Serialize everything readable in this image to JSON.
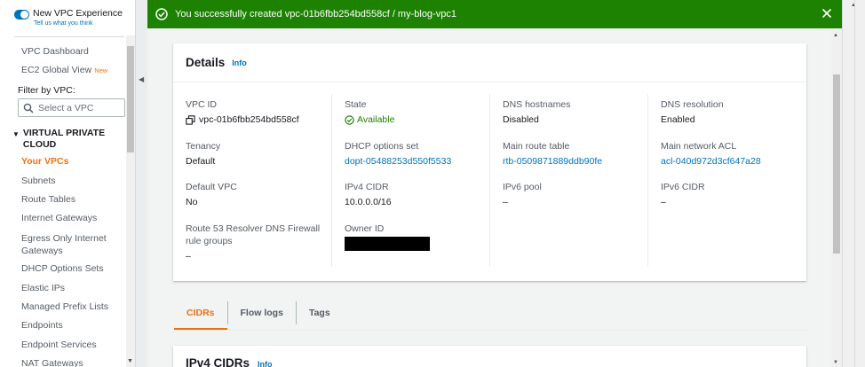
{
  "sidebar": {
    "toggle_title": "New VPC Experience",
    "toggle_subtitle": "Tell us what you think",
    "vpc_dashboard": "VPC Dashboard",
    "ec2_global_view": "EC2 Global View",
    "new_badge": "New",
    "filter_label": "Filter by VPC:",
    "search_placeholder": "Select a VPC",
    "section_title": "VIRTUAL PRIVATE CLOUD",
    "items": [
      "Your VPCs",
      "Subnets",
      "Route Tables",
      "Internet Gateways",
      "Egress Only Internet Gateways",
      "DHCP Options Sets",
      "Elastic IPs",
      "Managed Prefix Lists",
      "Endpoints",
      "Endpoint Services",
      "NAT Gateways"
    ]
  },
  "flash": {
    "message": "You successfully created vpc-01b6fbb254bd558cf / my-blog-vpc1",
    "color": "#1d8102"
  },
  "details": {
    "title": "Details",
    "info": "Info",
    "vpc_id_label": "VPC ID",
    "vpc_id_value": "vpc-01b6fbb254bd558cf",
    "state_label": "State",
    "state_value": "Available",
    "dns_hostnames_label": "DNS hostnames",
    "dns_hostnames_value": "Disabled",
    "dns_resolution_label": "DNS resolution",
    "dns_resolution_value": "Enabled",
    "tenancy_label": "Tenancy",
    "tenancy_value": "Default",
    "dhcp_label": "DHCP options set",
    "dhcp_value": "dopt-05488253d550f5533",
    "main_route_label": "Main route table",
    "main_route_value": "rtb-0509871889ddb90fe",
    "main_acl_label": "Main network ACL",
    "main_acl_value": "acl-040d972d3cf647a28",
    "default_vpc_label": "Default VPC",
    "default_vpc_value": "No",
    "ipv4_label": "IPv4 CIDR",
    "ipv4_value": "10.0.0.0/16",
    "ipv6_pool_label": "IPv6 pool",
    "ipv6_pool_value": "–",
    "ipv6_cidr_label": "IPv6 CIDR",
    "ipv6_cidr_value": "–",
    "route53_label": "Route 53 Resolver DNS Firewall rule groups",
    "route53_value": "–",
    "owner_label": "Owner ID"
  },
  "tabs": [
    "CIDRs",
    "Flow logs",
    "Tags"
  ],
  "cidr_section": {
    "title": "IPv4 CIDRs",
    "info": "Info"
  },
  "colors": {
    "accent": "#ec7211",
    "link": "#0073bb",
    "success": "#1d8102"
  }
}
